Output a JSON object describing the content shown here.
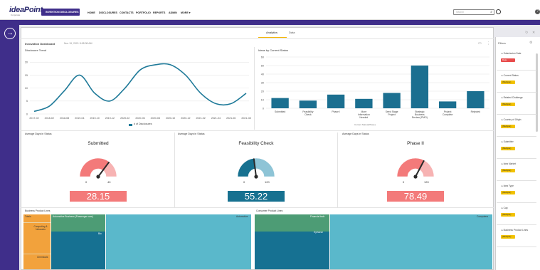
{
  "app": {
    "logo": "ideaPoint",
    "logo_sub": "Corporate",
    "workspace_button": "INVENTION DISCLOSURES"
  },
  "nav": [
    "HOME",
    "DISCLOSURES",
    "CONTACTS",
    "PORTFOLIO",
    "REPORTS",
    "ADMIN",
    "MORE ▾"
  ],
  "search": {
    "placeholder": "Search"
  },
  "tabs": [
    "Analytics",
    "Data"
  ],
  "dashboard": {
    "title": "Innovation Dashboard",
    "date": "Nov 19, 2021 8:08:38 AM"
  },
  "line_chart": {
    "title": "Disclosure Trend",
    "legend": "# of Disclosures",
    "color": "#1f7a99"
  },
  "bar_chart": {
    "title": "Ideas by Current Status",
    "xaxis_title": "Current Status(Phase)",
    "color": "#1b6f90"
  },
  "chart_data": [
    {
      "type": "line",
      "title": "Disclosure Trend",
      "x": [
        "2017-02",
        "2018-02",
        "2018-08",
        "2019-04",
        "2019-10",
        "2019-12",
        "2020-02",
        "2020-06",
        "2020-08",
        "2020-10",
        "2020-12",
        "2021-02",
        "2021-04",
        "2021-06",
        "2021-08"
      ],
      "series": [
        {
          "name": "# of Disclosures",
          "values": [
            1,
            3,
            9,
            15,
            8,
            5,
            10,
            17,
            19,
            19,
            15,
            8,
            4,
            4,
            8
          ]
        }
      ],
      "ylim": [
        0,
        22
      ],
      "yticks": [
        0,
        5,
        10,
        15,
        20
      ],
      "yticks_text": [
        "0",
        "5",
        "10",
        "15",
        "20"
      ],
      "grid": true,
      "legend": "bottom"
    },
    {
      "type": "bar",
      "title": "Ideas by Current Status",
      "categories": [
        "Submitted",
        "Feasibility Check",
        "Phase I",
        "More Information Needed",
        "Seed Stage Project",
        "Strategic Business Review (PMO)",
        "Project Complete",
        "Rejected"
      ],
      "values": [
        12,
        9,
        16,
        11,
        18,
        50,
        8,
        20
      ],
      "xlabel": "Current Status(Phase)",
      "ylim": [
        0,
        60
      ],
      "yticks_text": [
        "0",
        "10",
        "20",
        "30",
        "40",
        "50",
        "60"
      ],
      "grid": true
    }
  ],
  "gauges": [
    {
      "section": "Average Days in Status",
      "title": "Submitted",
      "value": "28.15",
      "numeric": 28.15,
      "min": "0",
      "max": "40",
      "box_color": "#f37a7a"
    },
    {
      "section": "Average Days in Status",
      "title": "Feasibility Check",
      "value": "55.22",
      "numeric": 55.22,
      "min": "0",
      "max": "120",
      "box_color": "#177190"
    },
    {
      "section": "Average Days in Status",
      "title": "Phase II",
      "value": "78.49",
      "numeric": 78.49,
      "min": "0",
      "max": "120",
      "box_color": "#f37a7a"
    }
  ],
  "treemaps": [
    {
      "title": "Business Product Lines",
      "tiles": [
        {
          "label": "Totals",
          "color": "#f2a23c"
        },
        {
          "label": "Computing & Networks",
          "color": "#f2a23c"
        },
        {
          "label": "Chemicals",
          "color": "#f2a23c"
        },
        {
          "label": "Automotive Business (Passenger cars)",
          "color": "#4d9c75"
        },
        {
          "label": "Bio",
          "color": "#167192"
        },
        {
          "label": "Automotive",
          "color": "#5ab8cb"
        }
      ]
    },
    {
      "title": "Consumer Product Lines",
      "tiles": [
        {
          "label": "Financial tech",
          "color": "#4d9c75"
        },
        {
          "label": "Eyewear",
          "color": "#167192"
        },
        {
          "label": "Computers",
          "color": "#5ab8cb"
        }
      ]
    }
  ],
  "filters": {
    "title": "Filters",
    "items": [
      {
        "label": "Submission Date",
        "chip": "Date",
        "chip_style": "red"
      },
      {
        "label": "Current Status",
        "chip": "(Multiple)",
        "chip_style": "yellow"
      },
      {
        "label": "Related Challenge",
        "chip": "(Multiple)",
        "chip_style": "yellow"
      },
      {
        "label": "Country of Origin",
        "chip": "(Multiple)",
        "chip_style": "yellow"
      },
      {
        "label": "Submitter",
        "chip": "(Multiple)",
        "chip_style": "yellow"
      },
      {
        "label": "Idea Market",
        "chip": "(Multiple)",
        "chip_style": "yellow"
      },
      {
        "label": "Idea Type",
        "chip": "(Multiple)",
        "chip_style": "yellow"
      },
      {
        "label": "Cap",
        "chip": "(Multiple)",
        "chip_style": "yellow"
      },
      {
        "label": "Business Product Lines",
        "chip": "(Multiple)",
        "chip_style": "yellow"
      }
    ]
  }
}
